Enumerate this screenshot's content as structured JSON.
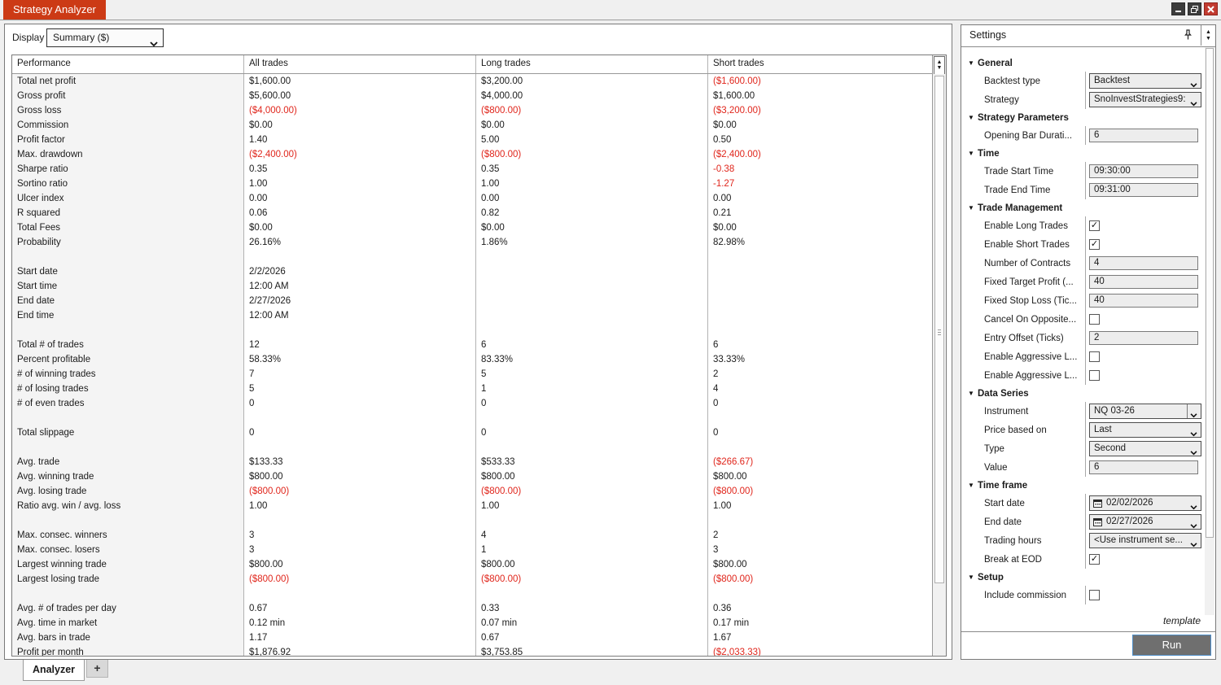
{
  "window": {
    "title": "Strategy Analyzer"
  },
  "display": {
    "label": "Display",
    "value": "Summary ($)"
  },
  "table": {
    "columns": [
      "Performance",
      "All trades",
      "Long trades",
      "Short trades"
    ],
    "rows": [
      {
        "label": "Total net profit",
        "all": "$1,600.00",
        "long": "$3,200.00",
        "short": "($1,600.00)"
      },
      {
        "label": "Gross profit",
        "all": "$5,600.00",
        "long": "$4,000.00",
        "short": "$1,600.00"
      },
      {
        "label": "Gross loss",
        "all": "($4,000.00)",
        "long": "($800.00)",
        "short": "($3,200.00)"
      },
      {
        "label": "Commission",
        "all": "$0.00",
        "long": "$0.00",
        "short": "$0.00"
      },
      {
        "label": "Profit factor",
        "all": "1.40",
        "long": "5.00",
        "short": "0.50"
      },
      {
        "label": "Max. drawdown",
        "all": "($2,400.00)",
        "long": "($800.00)",
        "short": "($2,400.00)"
      },
      {
        "label": "Sharpe ratio",
        "all": "0.35",
        "long": "0.35",
        "short": "-0.38"
      },
      {
        "label": "Sortino ratio",
        "all": "1.00",
        "long": "1.00",
        "short": "-1.27"
      },
      {
        "label": "Ulcer index",
        "all": "0.00",
        "long": "0.00",
        "short": "0.00"
      },
      {
        "label": "R squared",
        "all": "0.06",
        "long": "0.82",
        "short": "0.21"
      },
      {
        "label": "Total Fees",
        "all": "$0.00",
        "long": "$0.00",
        "short": "$0.00"
      },
      {
        "label": "Probability",
        "all": "26.16%",
        "long": "1.86%",
        "short": "82.98%"
      },
      {
        "label": "",
        "all": "",
        "long": "",
        "short": ""
      },
      {
        "label": "Start date",
        "all": "2/2/2026",
        "long": "",
        "short": ""
      },
      {
        "label": "Start time",
        "all": "12:00 AM",
        "long": "",
        "short": ""
      },
      {
        "label": "End date",
        "all": "2/27/2026",
        "long": "",
        "short": ""
      },
      {
        "label": "End time",
        "all": "12:00 AM",
        "long": "",
        "short": ""
      },
      {
        "label": "",
        "all": "",
        "long": "",
        "short": ""
      },
      {
        "label": "Total # of trades",
        "all": "12",
        "long": "6",
        "short": "6"
      },
      {
        "label": "Percent profitable",
        "all": "58.33%",
        "long": "83.33%",
        "short": "33.33%"
      },
      {
        "label": "# of winning trades",
        "all": "7",
        "long": "5",
        "short": "2"
      },
      {
        "label": "# of losing trades",
        "all": "5",
        "long": "1",
        "short": "4"
      },
      {
        "label": "# of even trades",
        "all": "0",
        "long": "0",
        "short": "0"
      },
      {
        "label": "",
        "all": "",
        "long": "",
        "short": ""
      },
      {
        "label": "Total slippage",
        "all": "0",
        "long": "0",
        "short": "0"
      },
      {
        "label": "",
        "all": "",
        "long": "",
        "short": ""
      },
      {
        "label": "Avg. trade",
        "all": "$133.33",
        "long": "$533.33",
        "short": "($266.67)"
      },
      {
        "label": "Avg. winning trade",
        "all": "$800.00",
        "long": "$800.00",
        "short": "$800.00"
      },
      {
        "label": "Avg. losing trade",
        "all": "($800.00)",
        "long": "($800.00)",
        "short": "($800.00)"
      },
      {
        "label": "Ratio avg. win / avg. loss",
        "all": "1.00",
        "long": "1.00",
        "short": "1.00"
      },
      {
        "label": "",
        "all": "",
        "long": "",
        "short": ""
      },
      {
        "label": "Max. consec. winners",
        "all": "3",
        "long": "4",
        "short": "2"
      },
      {
        "label": "Max. consec. losers",
        "all": "3",
        "long": "1",
        "short": "3"
      },
      {
        "label": "Largest winning trade",
        "all": "$800.00",
        "long": "$800.00",
        "short": "$800.00"
      },
      {
        "label": "Largest losing trade",
        "all": "($800.00)",
        "long": "($800.00)",
        "short": "($800.00)"
      },
      {
        "label": "",
        "all": "",
        "long": "",
        "short": ""
      },
      {
        "label": "Avg. # of trades per day",
        "all": "0.67",
        "long": "0.33",
        "short": "0.36"
      },
      {
        "label": "Avg. time in market",
        "all": "0.12 min",
        "long": "0.07 min",
        "short": "0.17 min"
      },
      {
        "label": "Avg. bars in trade",
        "all": "1.17",
        "long": "0.67",
        "short": "1.67"
      },
      {
        "label": "Profit per month",
        "all": "$1,876.92",
        "long": "$3,753.85",
        "short": "($2,033.33)"
      }
    ]
  },
  "tabs": {
    "active": "Analyzer",
    "add": "+"
  },
  "settings": {
    "title": "Settings",
    "sections": [
      {
        "title": "General",
        "rows": [
          {
            "label": "Backtest type",
            "type": "select",
            "value": "Backtest"
          },
          {
            "label": "Strategy",
            "type": "select",
            "value": "SnoInvestStrategies9:"
          }
        ]
      },
      {
        "title": "Strategy Parameters",
        "rows": [
          {
            "label": "Opening Bar Durati...",
            "type": "input",
            "value": "6"
          }
        ]
      },
      {
        "title": "Time",
        "rows": [
          {
            "label": "Trade Start Time",
            "type": "input",
            "value": "09:30:00"
          },
          {
            "label": "Trade End Time",
            "type": "input",
            "value": "09:31:00"
          }
        ]
      },
      {
        "title": "Trade Management",
        "rows": [
          {
            "label": "Enable Long Trades",
            "type": "checkbox",
            "checked": true
          },
          {
            "label": "Enable Short Trades",
            "type": "checkbox",
            "checked": true
          },
          {
            "label": "Number of Contracts",
            "type": "input",
            "value": "4"
          },
          {
            "label": "Fixed Target Profit (...",
            "type": "input",
            "value": "40"
          },
          {
            "label": "Fixed Stop Loss (Tic...",
            "type": "input",
            "value": "40"
          },
          {
            "label": "Cancel On Opposite...",
            "type": "checkbox",
            "checked": false
          },
          {
            "label": "Entry Offset (Ticks)",
            "type": "input",
            "value": "2"
          },
          {
            "label": "Enable Aggressive L...",
            "type": "checkbox",
            "checked": false
          },
          {
            "label": "Enable Aggressive L...",
            "type": "checkbox",
            "checked": false
          }
        ]
      },
      {
        "title": "Data Series",
        "rows": [
          {
            "label": "Instrument",
            "type": "splitselect",
            "value": "NQ 03-26"
          },
          {
            "label": "Price based on",
            "type": "select",
            "value": "Last"
          },
          {
            "label": "Type",
            "type": "select",
            "value": "Second"
          },
          {
            "label": "Value",
            "type": "input",
            "value": "6"
          }
        ]
      },
      {
        "title": "Time frame",
        "rows": [
          {
            "label": "Start date",
            "type": "dateselect",
            "value": "02/02/2026"
          },
          {
            "label": "End date",
            "type": "dateselect",
            "value": "02/27/2026"
          },
          {
            "label": "Trading hours",
            "type": "select",
            "value": "<Use instrument se..."
          },
          {
            "label": "Break at EOD",
            "type": "checkbox",
            "checked": true
          }
        ]
      },
      {
        "title": "Setup",
        "rows": [
          {
            "label": "Include commission",
            "type": "checkbox",
            "checked": false
          }
        ]
      }
    ],
    "template_link": "template",
    "run_button": "Run"
  },
  "icons": {
    "check": "✓",
    "collapse": "▼",
    "spin_up": "▲",
    "spin_down": "▼"
  },
  "colors": {
    "accent": "#cc3a15",
    "negative": "#e0261c"
  }
}
